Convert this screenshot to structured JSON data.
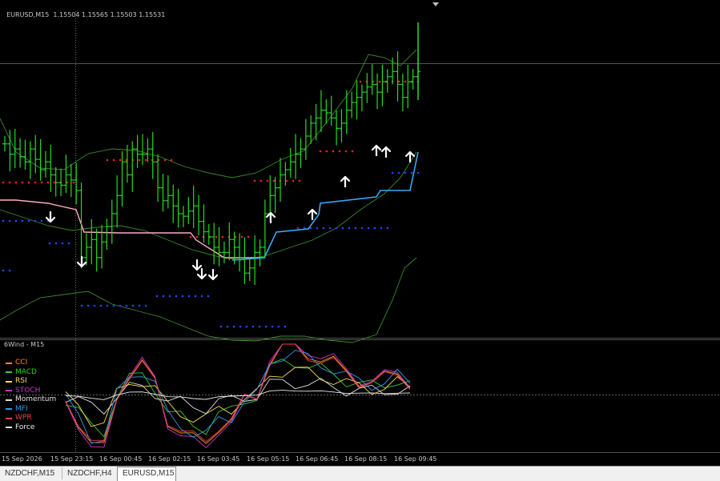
{
  "header": {
    "symbol": "EURUSD,M15",
    "prices": "1.15504 1.15565 1.15503 1.15531"
  },
  "sub_window": {
    "title": "6Wind - M15",
    "legend": [
      {
        "name": "CCI",
        "color": "#ff8c1a"
      },
      {
        "name": "MACD",
        "color": "#33cc33"
      },
      {
        "name": "RSI",
        "color": "#ffdd55"
      },
      {
        "name": "STOCH",
        "color": "#cc33cc"
      },
      {
        "name": "Momentum",
        "color": "#e0e0e0"
      },
      {
        "name": "MFI",
        "color": "#3399ee"
      },
      {
        "name": "WPR",
        "color": "#ee4444"
      },
      {
        "name": "Force",
        "color": "#eeeeee"
      }
    ]
  },
  "time_axis": [
    "15 Sep 2026",
    "15 Sep 23:15",
    "16 Sep 00:45",
    "16 Sep 02:15",
    "16 Sep 03:45",
    "16 Sep 05:15",
    "16 Sep 06:45",
    "16 Sep 08:15",
    "16 Sep 09:45"
  ],
  "tabs": [
    {
      "label": "NZDCHF,M15",
      "active": false
    },
    {
      "label": "NZDCHF,H4",
      "active": false
    },
    {
      "label": "EURUSD,M15",
      "active": true
    }
  ],
  "colors": {
    "bars": "#22dd22",
    "resistance_dots": "#ee2222",
    "support_dots": "#2244ff",
    "trend_line_up": "#33aaff",
    "trend_line_down": "#ffaacc",
    "envelope": "#3a8a2a",
    "arrows": "#ffffff"
  },
  "chart_data": {
    "type": "line",
    "title": "EURUSD,M15",
    "last_quote": {
      "open": 1.15504,
      "high": 1.15565,
      "low": 1.15503,
      "close": 1.15531
    },
    "x_tick_labels": [
      "15 Sep 2026",
      "15 Sep 23:15",
      "16 Sep 00:45",
      "16 Sep 02:15",
      "16 Sep 03:45",
      "16 Sep 05:15",
      "16 Sep 06:45",
      "16 Sep 08:15",
      "16 Sep 09:45"
    ],
    "price_panel": {
      "series": [
        {
          "values": [
            0.62,
            0.58,
            0.6,
            0.57,
            0.55,
            0.6,
            0.56,
            0.52,
            0.55,
            0.5,
            0.47,
            0.46,
            0.5,
            0.48,
            0.44,
            0.18,
            0.22,
            0.25,
            0.18,
            0.24,
            0.3,
            0.35,
            0.42,
            0.55,
            0.5,
            0.6,
            0.58,
            0.58,
            0.6,
            0.55,
            0.45,
            0.4,
            0.42,
            0.38,
            0.35,
            0.34,
            0.36,
            0.38,
            0.32,
            0.28,
            0.26,
            0.22,
            0.2,
            0.2,
            0.25,
            0.22,
            0.18,
            0.12,
            0.14,
            0.2,
            0.22,
            0.35,
            0.42,
            0.45,
            0.5,
            0.52,
            0.55,
            0.58,
            0.6,
            0.65,
            0.7,
            0.72,
            0.75,
            0.74,
            0.72,
            0.68,
            0.7,
            0.75,
            0.78,
            0.8,
            0.82,
            0.84,
            0.85,
            0.82,
            0.86,
            0.88,
            0.9,
            0.85,
            0.8,
            0.86,
            0.88,
            0.9
          ]
        }
      ],
      "arrows_down": 5,
      "arrows_up": 6
    },
    "indicator_panel": {
      "series": [
        {
          "name": "CCI"
        },
        {
          "name": "MACD"
        },
        {
          "name": "RSI"
        },
        {
          "name": "STOCH"
        },
        {
          "name": "Momentum"
        },
        {
          "name": "MFI"
        },
        {
          "name": "WPR"
        },
        {
          "name": "Force"
        }
      ]
    }
  }
}
